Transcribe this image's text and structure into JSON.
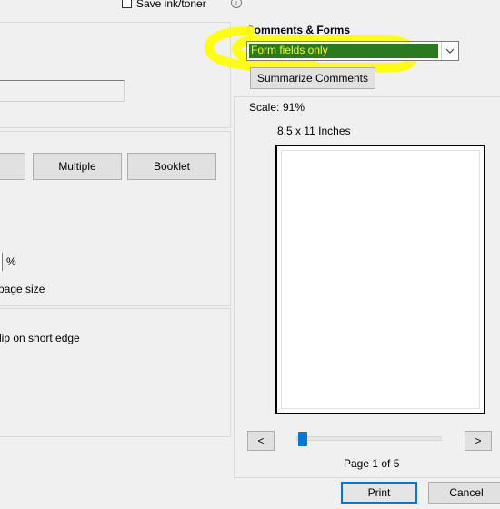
{
  "top": {
    "save_ink_label": "Save ink/toner"
  },
  "left": {
    "multiple_label": "Multiple",
    "booklet_label": "Booklet",
    "percent_label": "%",
    "page_size_label": "page size",
    "flip_label": "lip on short edge"
  },
  "comments_forms": {
    "heading": "Comments & Forms",
    "selected": "Form fields only",
    "summarize_label": "Summarize Comments"
  },
  "preview": {
    "scale_label": "Scale:",
    "scale_value": "91%",
    "paper_size": "8.5 x 11 Inches",
    "page_indicator": "Page 1 of 5",
    "prev_label": "<",
    "next_label": ">",
    "progress": 0.0
  },
  "footer": {
    "print_label": "Print",
    "cancel_label": "Cancel"
  },
  "annotation": {
    "highlight_color": "#ffff00"
  }
}
